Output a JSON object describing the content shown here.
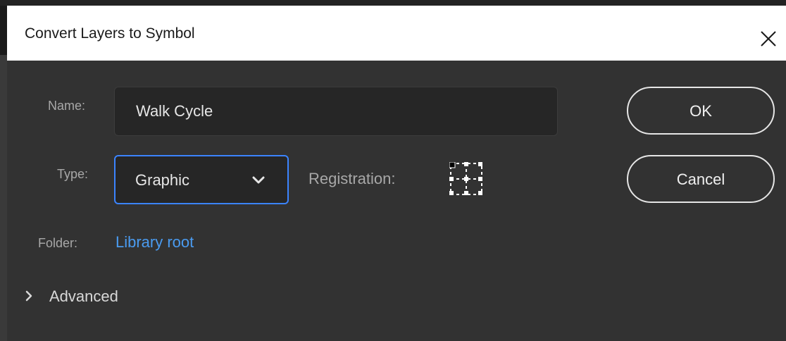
{
  "dialog": {
    "title": "Convert Layers to Symbol",
    "close_icon": "close-icon"
  },
  "form": {
    "name_label": "Name:",
    "name_value": "Walk Cycle",
    "type_label": "Type:",
    "type_value": "Graphic",
    "registration_label": "Registration:",
    "registration_selected": "top-left",
    "folder_label": "Folder:",
    "folder_value": "Library root",
    "advanced_label": "Advanced"
  },
  "buttons": {
    "ok_label": "OK",
    "cancel_label": "Cancel"
  },
  "colors": {
    "accent_blue": "#3b84ff",
    "link_blue": "#4a9bf0",
    "panel_bg": "#323232"
  }
}
